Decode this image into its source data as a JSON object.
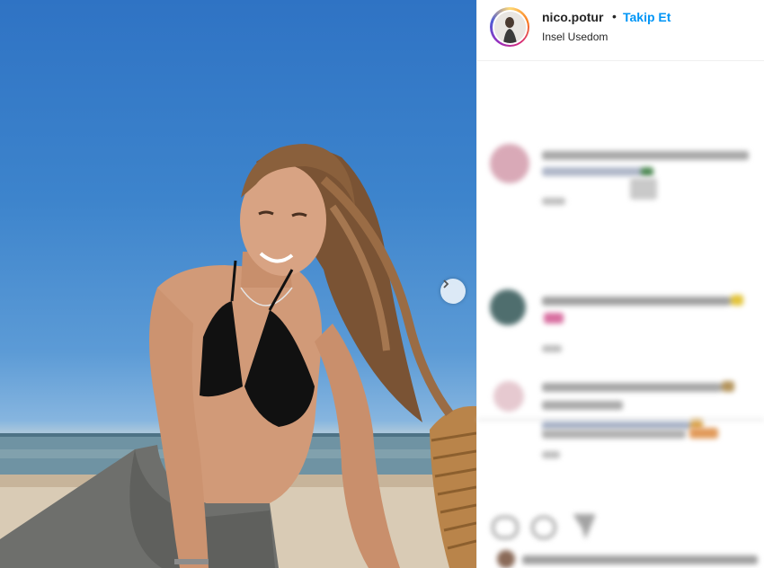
{
  "post": {
    "username": "nico.potur",
    "separator": "•",
    "follow_label": "Takip Et",
    "location": "Insel Usedom"
  },
  "icons": {
    "next": "chevron-right-icon",
    "like": "heart-icon",
    "comment": "comment-icon",
    "share": "share-icon"
  },
  "colors": {
    "follow_blue": "#0095f6",
    "text": "#262626",
    "border": "#efefef"
  }
}
